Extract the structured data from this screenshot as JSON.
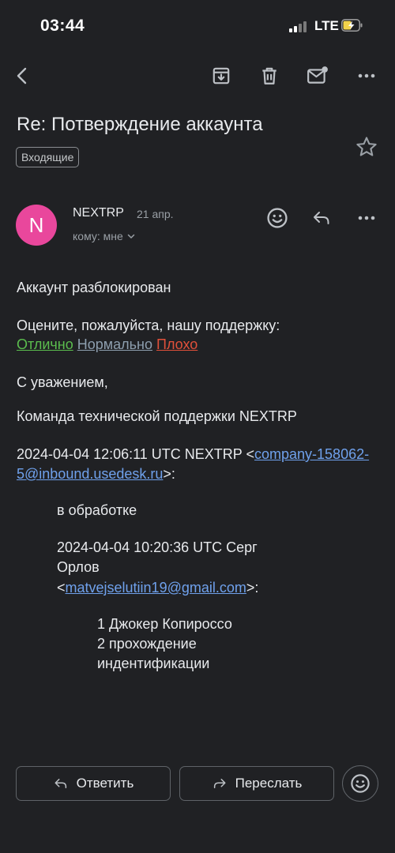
{
  "status_bar": {
    "time": "03:44",
    "network": "LTE"
  },
  "email": {
    "subject": "Re: Потверждение аккаунта",
    "label": "Входящие",
    "sender": {
      "name": "NEXTRP",
      "initial": "N",
      "avatar_color": "#e9479c"
    },
    "date": "21 апр.",
    "recipient": "кому: мне",
    "body": {
      "line1": "Аккаунт разблокирован",
      "rating_prompt": "Оцените, пожалуйста, нашу поддержку:",
      "rating_options": {
        "good": "Отлично",
        "normal": "Нормально",
        "bad": "Плохо"
      },
      "closing": "С уважением,",
      "signature": "Команда технической поддержки NEXTRP",
      "quote1_header_prefix": "2024-04-04 12:06:11 UTC NEXTRP <",
      "quote1_email": "company-158062-5@inbound.usedesk.ru",
      "quote1_header_suffix": ">:",
      "quote1_text": "в обработке",
      "quote2_header_line1": "2024-04-04 10:20:36 UTC Серг",
      "quote2_header_line2": "Орлов",
      "quote2_email_prefix": "<",
      "quote2_email": "matvejselutiin19@gmail.com",
      "quote2_email_suffix": ">:",
      "quote2_line1": "1 Джокер Копироссо",
      "quote2_line2": "2 прохождение",
      "quote2_line3": "индентификации"
    }
  },
  "actions": {
    "reply": "Ответить",
    "forward": "Переслать"
  },
  "icons": [
    "back-arrow-icon",
    "archive-icon",
    "trash-icon",
    "mark-unread-icon",
    "more-vert-icon",
    "star-icon",
    "smiley-icon",
    "reply-icon",
    "chevron-down-icon",
    "forward-icon"
  ],
  "colors": {
    "background": "#202124",
    "link_blue": "#6fa1ec",
    "link_green": "#5bbd4e",
    "link_gray": "#8d9eae",
    "link_red": "#e0503a"
  }
}
